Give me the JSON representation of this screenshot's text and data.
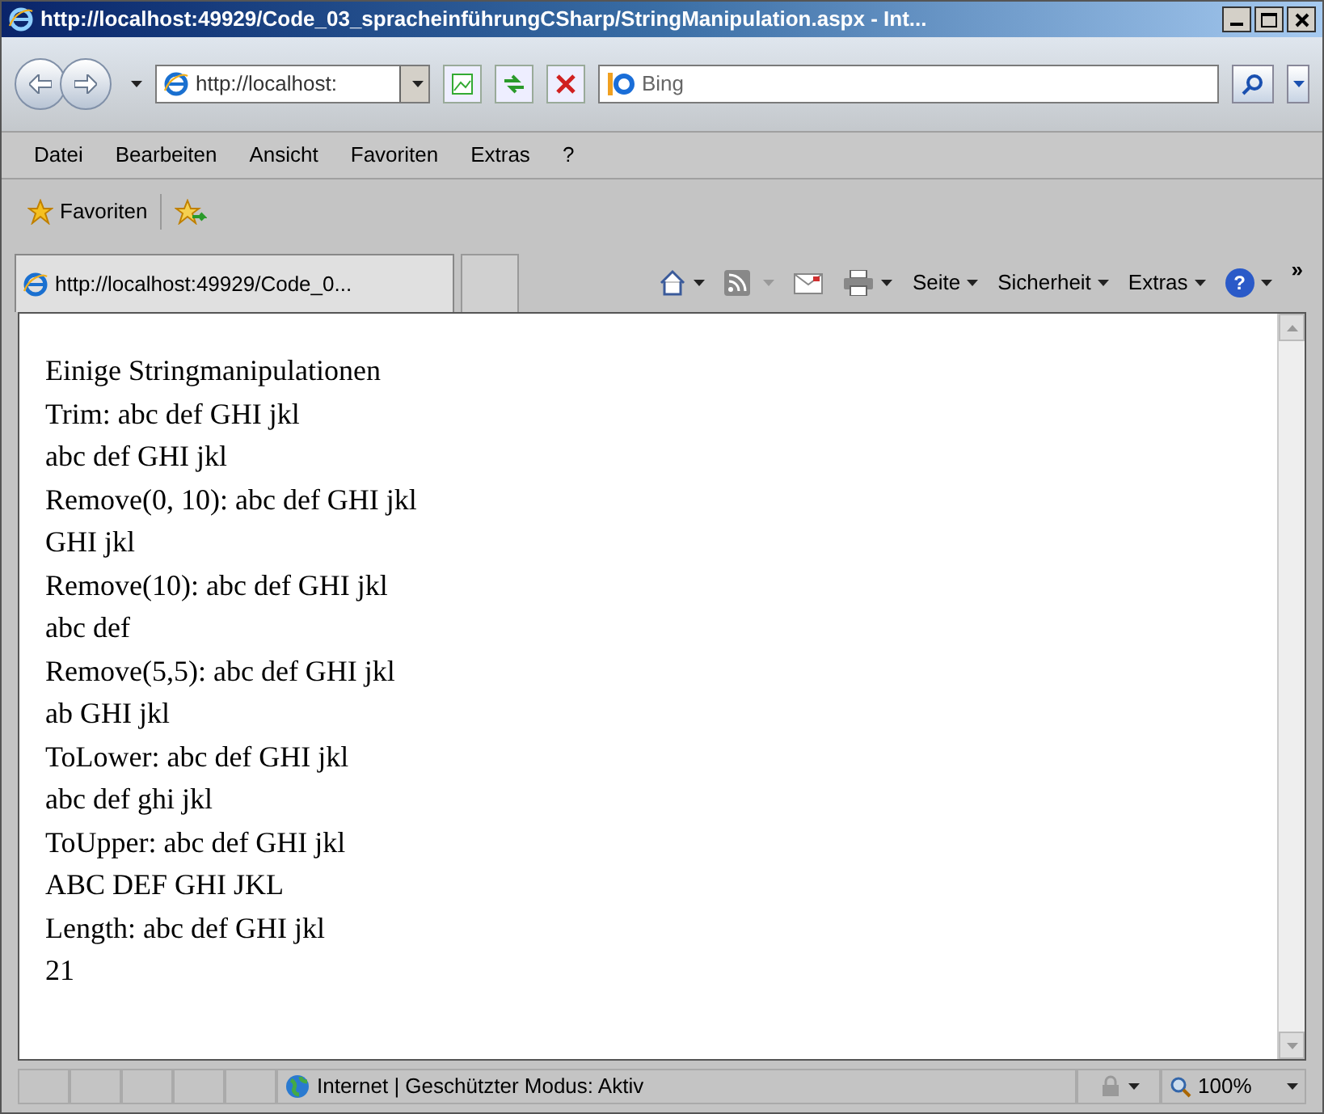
{
  "window": {
    "title": "http://localhost:49929/Code_03_spracheinführungCSharp/StringManipulation.aspx - Int..."
  },
  "address_bar": {
    "value": "http://localhost:"
  },
  "search": {
    "placeholder": "Bing"
  },
  "menu": [
    "Datei",
    "Bearbeiten",
    "Ansicht",
    "Favoriten",
    "Extras",
    "?"
  ],
  "favorites_bar": {
    "label": "Favoriten"
  },
  "tab": {
    "label": "http://localhost:49929/Code_0..."
  },
  "command_bar": [
    "Seite",
    "Sicherheit",
    "Extras"
  ],
  "help_button": {
    "label": "?"
  },
  "overflow": {
    "label": "»"
  },
  "content": [
    "Einige Stringmanipulationen",
    "Trim: abc def GHI jkl",
    "abc def GHI jkl",
    "Remove(0, 10): abc def GHI jkl",
    "GHI jkl",
    "Remove(10): abc def GHI jkl",
    "abc def",
    "Remove(5,5): abc def GHI jkl",
    "ab GHI jkl",
    "ToLower: abc def GHI jkl",
    "abc def ghi jkl",
    "ToUpper: abc def GHI jkl",
    "ABC DEF GHI JKL",
    "Length: abc def GHI jkl",
    "21"
  ],
  "status_bar": {
    "zone": "Internet | Geschützter Modus: Aktiv",
    "zoom": "100%"
  }
}
